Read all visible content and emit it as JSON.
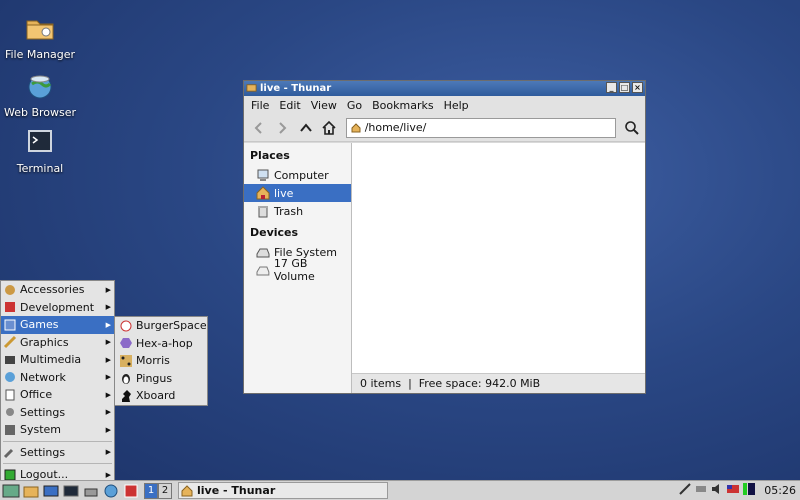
{
  "desktop": {
    "icons": [
      {
        "label": "File Manager",
        "icon": "file-manager-icon"
      },
      {
        "label": "Web Browser",
        "icon": "web-browser-icon"
      },
      {
        "label": "Terminal",
        "icon": "terminal-icon"
      }
    ]
  },
  "window": {
    "title": "live - Thunar",
    "menu": [
      "File",
      "Edit",
      "View",
      "Go",
      "Bookmarks",
      "Help"
    ],
    "location": "/home/live/",
    "sidebar": {
      "places_header": "Places",
      "places": [
        "Computer",
        "live",
        "Trash"
      ],
      "devices_header": "Devices",
      "devices": [
        "File System",
        "17 GB Volume"
      ]
    },
    "status": "0 items  |  Free space: 942.0 MiB"
  },
  "start_menu": {
    "items": [
      "Accessories",
      "Development",
      "Games",
      "Graphics",
      "Multimedia",
      "Network",
      "Office",
      "Settings",
      "System"
    ],
    "bottom_items": [
      "Settings",
      "Logout..."
    ],
    "games_submenu": [
      "BurgerSpace",
      "Hex-a-hop",
      "Morris",
      "Pingus",
      "Xboard"
    ]
  },
  "taskbar": {
    "desktops": [
      "1",
      "2"
    ],
    "task_label": "live - Thunar",
    "clock": "05:26"
  },
  "colors": {
    "selection": "#3a6fc3",
    "titlebar": "#3f6aad",
    "desktop": "#2a4784"
  }
}
